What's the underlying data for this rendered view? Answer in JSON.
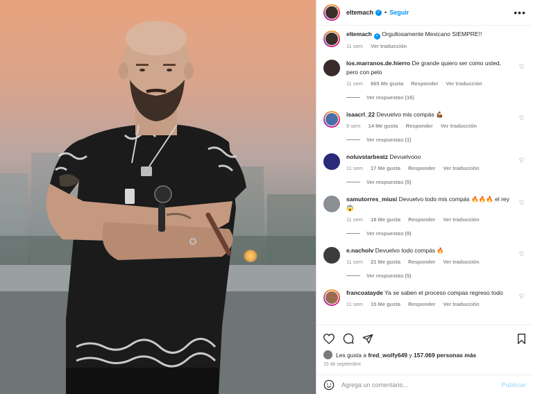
{
  "header": {
    "username": "eltemach",
    "separator": "•",
    "follow_label": "Seguir",
    "more_label": "•••"
  },
  "caption": {
    "username": "eltemach",
    "text": "Orgullosamente Mexicano SIEMPRE!!",
    "time": "11 sem",
    "translate": "Ver traducción"
  },
  "comments": [
    {
      "username": "los.marranos.de.hierro",
      "text": "De grande quiero ser como usted, pero con pelo",
      "time": "11 sem",
      "likes": "665 Me gusta",
      "reply": "Responder",
      "translate": "Ver traducción",
      "replies": "Ver respuestas (16)",
      "avatar_color": "#3a2b2b"
    },
    {
      "username": "isaacrl_22",
      "text": "Devuelvo mis compás 💪🏾",
      "time": "9 sem",
      "likes": "14 Me gusta",
      "reply": "Responder",
      "translate": "Ver traducción",
      "replies": "Ver respuestas (1)",
      "avatar_color": "#4a6ea8"
    },
    {
      "username": "noluvstarbeatz",
      "text": "Devuelvooo",
      "time": "11 sem",
      "likes": "17 Me gusta",
      "reply": "Responder",
      "translate": "Ver traducción",
      "replies": "Ver respuestas (5)",
      "avatar_color": "#2a2a7a"
    },
    {
      "username": "samutorres_miusi",
      "text": "Devuelvo todo mis compás 🔥🔥🔥 el rey😱",
      "time": "11 sem",
      "likes": "18 Me gusta",
      "reply": "Responder",
      "translate": "Ver traducción",
      "replies": "Ver respuestas (9)",
      "avatar_color": "#8a8f94"
    },
    {
      "username": "e.nacholv",
      "text": "Devuelvo todo compás 🔥",
      "time": "11 sem",
      "likes": "21 Me gusta",
      "reply": "Responder",
      "translate": "Ver traducción",
      "replies": "Ver respuestas (5)",
      "avatar_color": "#3c3c3c"
    },
    {
      "username": "francoatayde",
      "text": "Ya se saben el proceso compas regreso todo",
      "time": "11 sem",
      "likes": "15 Me gusta",
      "reply": "Responder",
      "translate": "Ver traducción",
      "replies": "",
      "avatar_color": "#9a6a50"
    }
  ],
  "likes_line": {
    "prefix": "Les gusta a",
    "user": "fred_wolfy649",
    "joiner": "y",
    "count": "157.069 personas más"
  },
  "date": "15 de septiembre",
  "add_comment": {
    "placeholder": "Agrega un comentario...",
    "post_label": "Publicar"
  },
  "colors": {
    "accent": "#0095f6",
    "muted": "#8e8e8e",
    "post_disabled": "#b2dffc"
  },
  "icons": [
    "heart-icon",
    "comment-icon",
    "share-icon",
    "bookmark-icon",
    "emoji-icon",
    "verified-icon",
    "more-icon"
  ]
}
